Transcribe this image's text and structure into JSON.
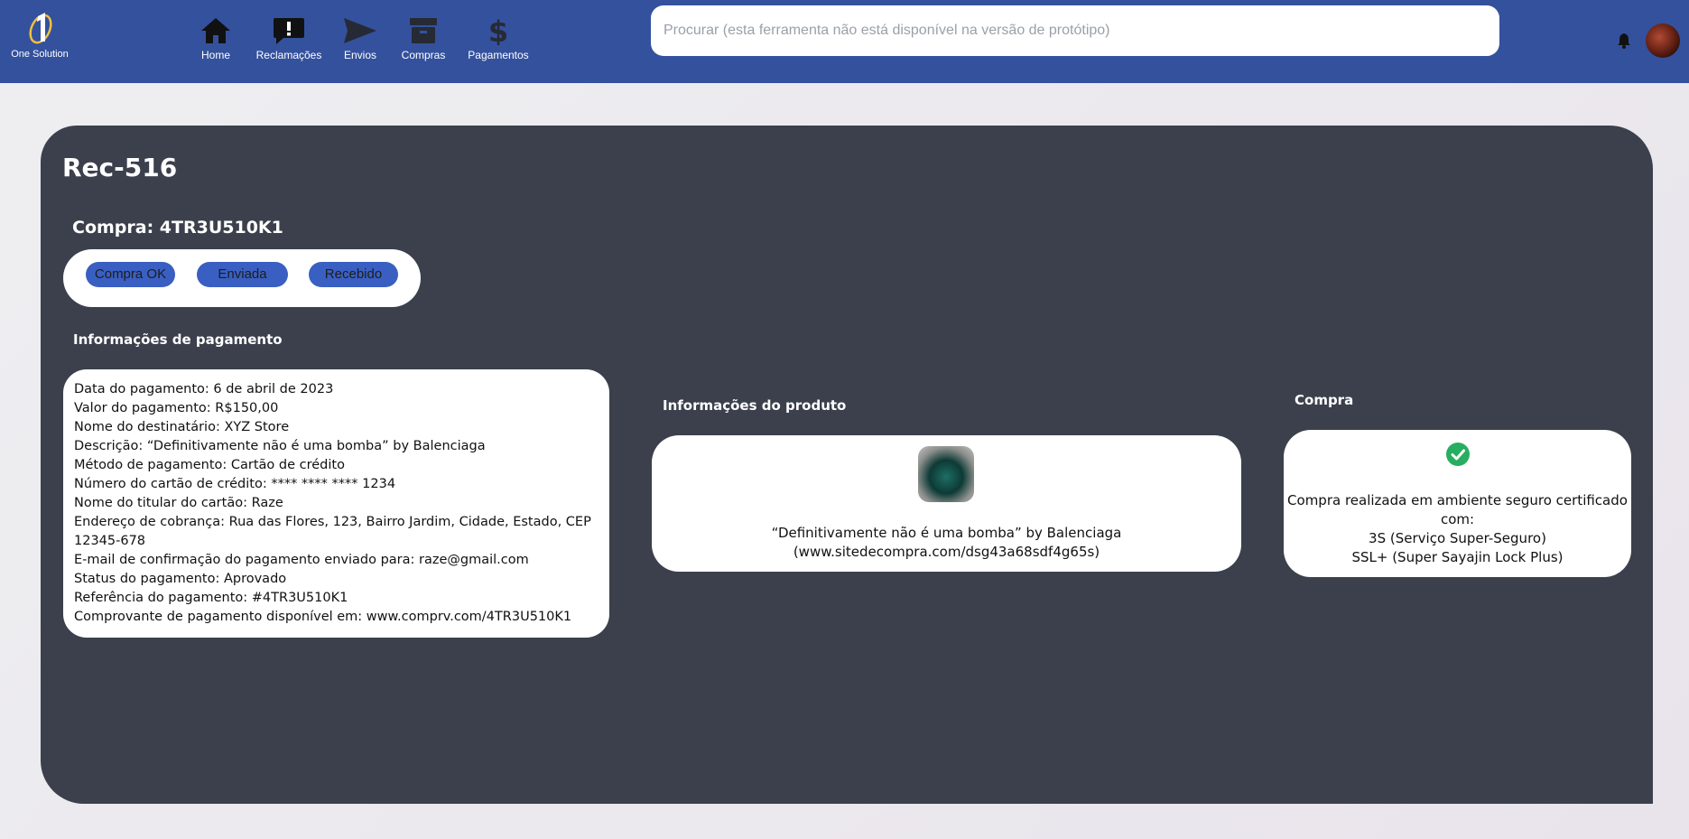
{
  "header": {
    "logo_text": "One Solution",
    "nav": [
      {
        "label": "Home",
        "icon": "home-icon"
      },
      {
        "label": "Reclamações",
        "icon": "complaint-icon"
      },
      {
        "label": "Envios",
        "icon": "send-icon"
      },
      {
        "label": "Compras",
        "icon": "archive-icon"
      },
      {
        "label": "Pagamentos",
        "icon": "dollar-icon"
      }
    ],
    "search_placeholder": "Procurar (esta ferramenta não está disponível na versão de protótipo)",
    "colors": {
      "bar": "#34519d",
      "panel": "#3b404c",
      "pill": "#3a5fc3",
      "check": "#27ae60"
    }
  },
  "main": {
    "title": "Rec-516",
    "compra_title": "Compra: 4TR3U510K1",
    "status": [
      "Compra OK",
      "Enviada",
      "Recebido"
    ],
    "payment": {
      "heading": "Informações de pagamento",
      "lines": [
        "Data do pagamento: 6 de abril de 2023",
        "Valor do pagamento: R$150,00",
        "Nome do destinatário: XYZ Store",
        "Descrição: “Definitivamente não é uma bomba” by Balenciaga",
        "Método de pagamento: Cartão de crédito",
        "Número do cartão de crédito: **** **** **** 1234",
        "Nome do titular do cartão: Raze",
        "Endereço de cobrança: Rua das Flores, 123, Bairro Jardim, Cidade, Estado, CEP 12345-678",
        "E-mail de confirmação do pagamento enviado para: raze@gmail.com",
        "Status do pagamento: Aprovado",
        "Referência do pagamento: #4TR3U510K1",
        "Comprovante de pagamento disponível em: www.comprv.com/4TR3U510K1"
      ]
    },
    "product": {
      "heading": "Informações do produto",
      "name": "“Definitivamente não é uma bomba” by Balenciaga",
      "url": "(www.sitedecompra.com/dsg43a68sdf4g65s)"
    },
    "purchase": {
      "heading": "Compra",
      "lines": [
        "Compra realizada em ambiente seguro certificado",
        "com:",
        "3S (Serviço Super-Seguro)",
        "SSL+ (Super Sayajin Lock Plus)"
      ]
    }
  }
}
